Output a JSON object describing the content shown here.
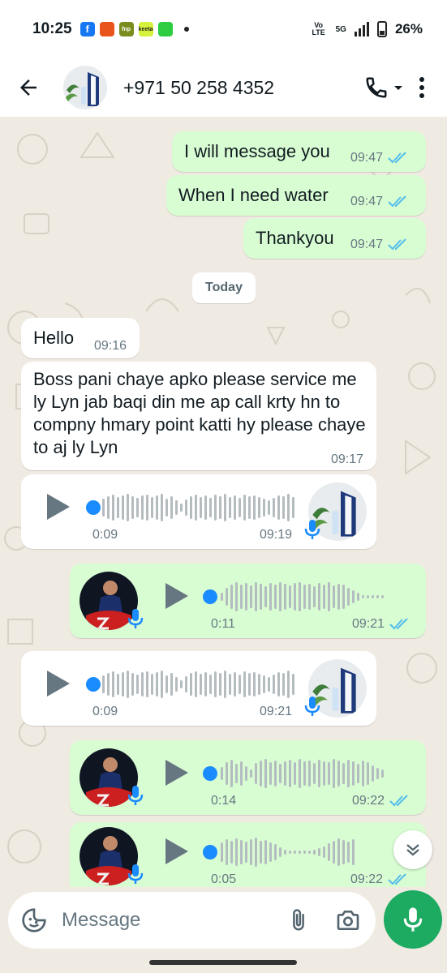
{
  "status_bar": {
    "time": "10:25",
    "network": "5G",
    "volte": "Vo LTE",
    "battery": "26%",
    "notification_apps": [
      "facebook",
      "grocery",
      "fnp",
      "keeta",
      "app"
    ],
    "notification_labels": [
      "f",
      "",
      "fnp",
      "keeta",
      ""
    ]
  },
  "header": {
    "contact": "+971 50 258 4352"
  },
  "messages": {
    "m1": {
      "text": "I will message you",
      "time": "09:47"
    },
    "m2": {
      "text": "When I need water",
      "time": "09:47"
    },
    "m3": {
      "text": "Thankyou",
      "time": "09:47"
    },
    "date_divider": "Today",
    "m4": {
      "text": "Hello",
      "time": "09:16"
    },
    "m5": {
      "text": "Boss pani chaye apko please service me ly Lyn jab baqi din me ap call krty hn to compny hmary point katti hy please chaye to aj ly Lyn",
      "time": "09:17"
    },
    "v1": {
      "duration": "0:09",
      "time": "09:19"
    },
    "v2": {
      "duration": "0:11",
      "time": "09:21"
    },
    "v3": {
      "duration": "0:09",
      "time": "09:21"
    },
    "v4": {
      "duration": "0:14",
      "time": "09:22"
    },
    "v5": {
      "duration": "0:05",
      "time": "09:22"
    }
  },
  "input": {
    "placeholder": "Message"
  },
  "colors": {
    "outgoing_bubble": "#d9fdd3",
    "incoming_bubble": "#ffffff",
    "chat_background": "#efeae2",
    "read_ticks": "#53bdeb",
    "mic_button": "#1daa61",
    "voice_progress": "#1a8cff"
  }
}
